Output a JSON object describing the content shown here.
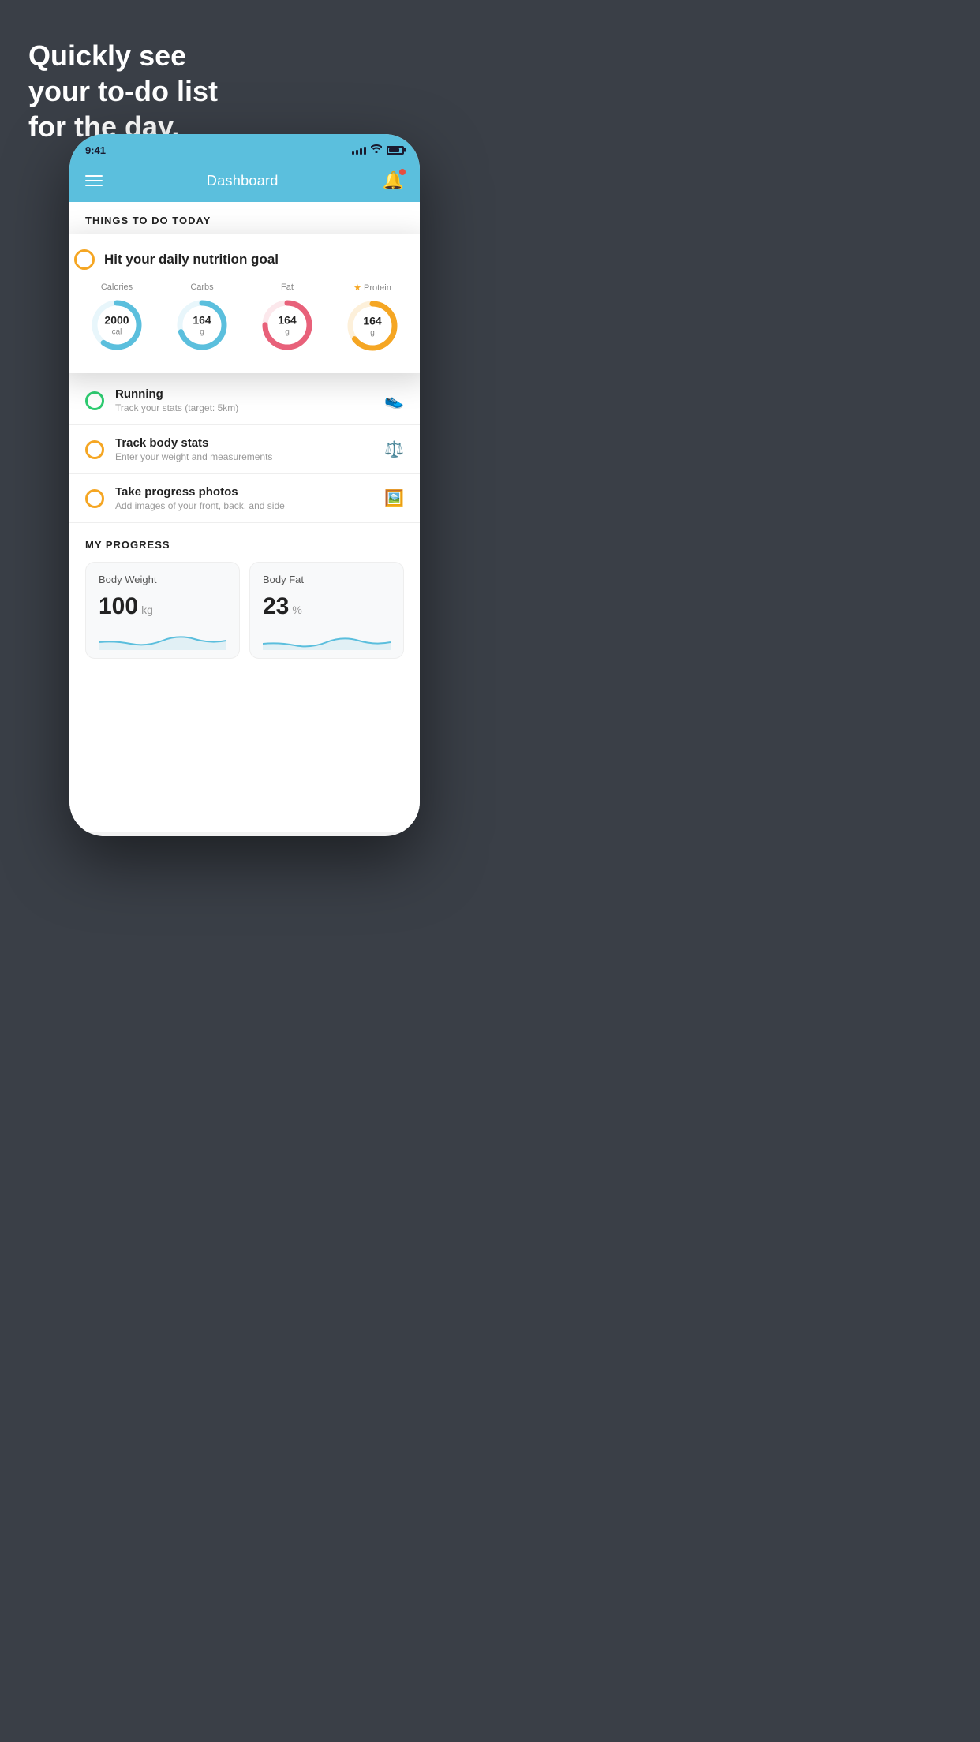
{
  "background": {
    "headline_line1": "Quickly see",
    "headline_line2": "your to-do list",
    "headline_line3": "for the day.",
    "color": "#3a3f47"
  },
  "status_bar": {
    "time": "9:41",
    "color": "#5bbfdd"
  },
  "nav_bar": {
    "title": "Dashboard",
    "color": "#5bbfdd"
  },
  "section_header": "THINGS TO DO TODAY",
  "floating_card": {
    "title": "Hit your daily nutrition goal",
    "nutrition": [
      {
        "label": "Calories",
        "value": "2000",
        "unit": "cal",
        "color": "#5bbfdd",
        "percent": 60,
        "starred": false
      },
      {
        "label": "Carbs",
        "value": "164",
        "unit": "g",
        "color": "#5bbfdd",
        "percent": 70,
        "starred": false
      },
      {
        "label": "Fat",
        "value": "164",
        "unit": "g",
        "color": "#e8617a",
        "percent": 75,
        "starred": false
      },
      {
        "label": "Protein",
        "value": "164",
        "unit": "g",
        "color": "#f5a623",
        "percent": 65,
        "starred": true
      }
    ]
  },
  "todo_items": [
    {
      "circle_color": "green",
      "title": "Running",
      "subtitle": "Track your stats (target: 5km)",
      "icon": "shoe"
    },
    {
      "circle_color": "yellow",
      "title": "Track body stats",
      "subtitle": "Enter your weight and measurements",
      "icon": "scale"
    },
    {
      "circle_color": "yellow",
      "title": "Take progress photos",
      "subtitle": "Add images of your front, back, and side",
      "icon": "photo"
    }
  ],
  "progress": {
    "section_title": "MY PROGRESS",
    "cards": [
      {
        "title": "Body Weight",
        "value": "100",
        "unit": "kg"
      },
      {
        "title": "Body Fat",
        "value": "23",
        "unit": "%"
      }
    ]
  }
}
